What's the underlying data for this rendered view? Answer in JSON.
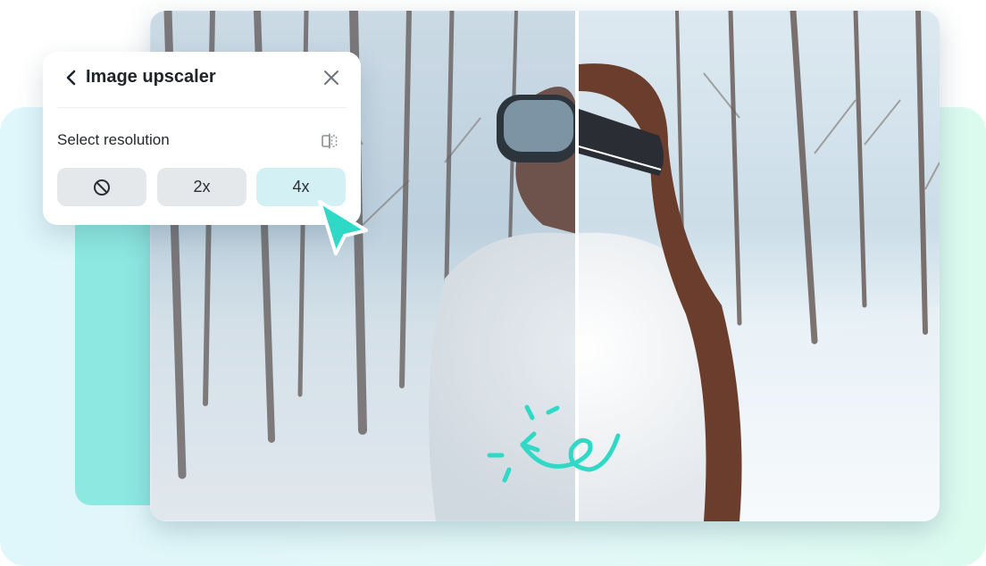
{
  "panel": {
    "title": "Image upscaler",
    "section_label": "Select resolution",
    "options": [
      {
        "label": "",
        "icon": "none-icon",
        "selected": false
      },
      {
        "label": "2x",
        "selected": false
      },
      {
        "label": "4x",
        "selected": true
      }
    ]
  },
  "colors": {
    "accent": "#2fd9c6",
    "selected_bg": "#d3f1f4",
    "teal_card": "#8ee8e2"
  },
  "icons": {
    "back": "chevron-left-icon",
    "close": "close-icon",
    "compare": "compare-icon",
    "none": "none-icon",
    "cursor": "cursor-icon"
  }
}
